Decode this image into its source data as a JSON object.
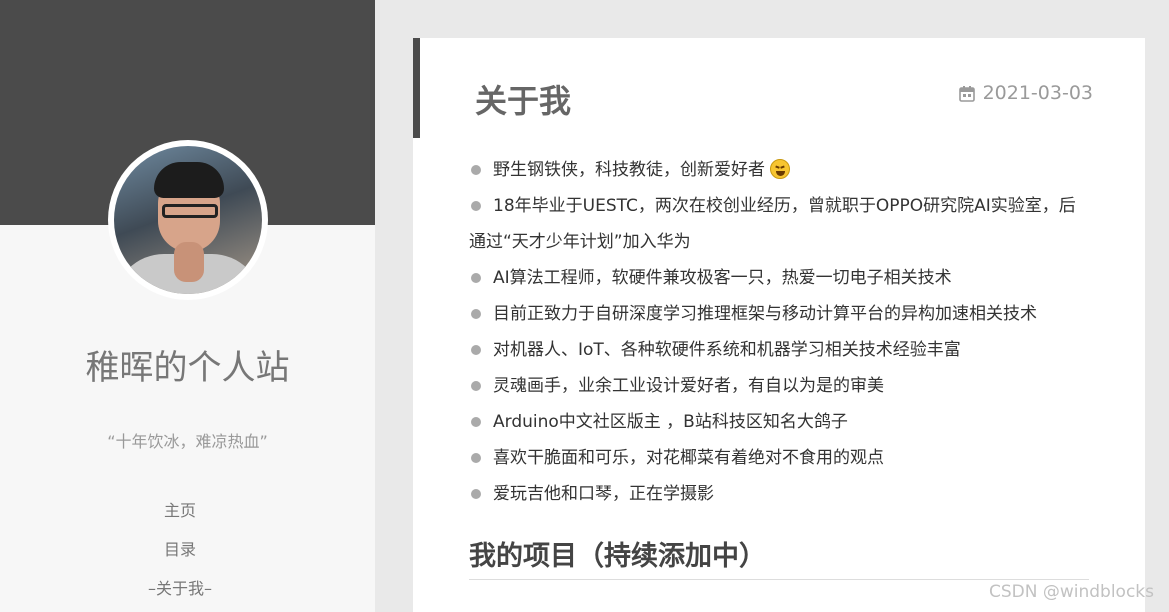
{
  "sidebar": {
    "site_title": "稚晖的个人站",
    "motto": "“十年饮冰，难凉热血”",
    "nav": [
      {
        "label": "主页"
      },
      {
        "label": "目录"
      },
      {
        "label": "–关于我–"
      }
    ]
  },
  "post": {
    "title": "关于我",
    "date": "2021-03-03",
    "bio": [
      "野生钢铁侠，科技教徒，创新爱好者",
      "18年毕业于UESTC，两次在校创业经历，曾就职于OPPO研究院AI实验室，后",
      "通过“天才少年计划”加入华为",
      "AI算法工程师，软硬件兼攻极客一只，热爱一切电子相关技术",
      "目前正致力于自研深度学习推理框架与移动计算平台的异构加速相关技术",
      "对机器人、IoT、各种软硬件系统和机器学习相关技术经验丰富",
      "灵魂画手，业余工业设计爱好者，有自以为是的审美",
      "Arduino中文社区版主 ，B站科技区知名大鸽子",
      "喜欢干脆面和可乐，对花椰菜有着绝对不食用的观点",
      "爱玩吉他和口琴，正在学摄影"
    ],
    "projects_heading": "我的项目（持续添加中）"
  },
  "watermark": "CSDN @windblocks",
  "colors": {
    "banner": "#4b4b4b",
    "page_bg": "#e9e9e9",
    "sidebar_bg": "#f7f7f7"
  }
}
